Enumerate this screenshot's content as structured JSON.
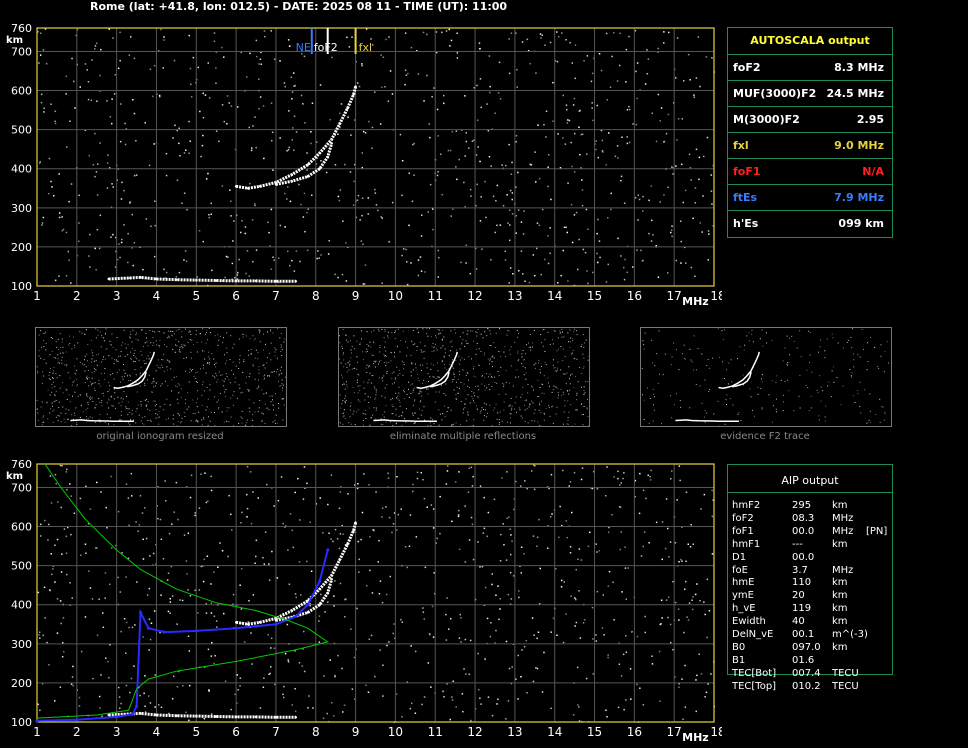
{
  "header": {
    "title": "Rome (lat: +41.8, lon: 012.5) - DATE: 2025 08 11 - TIME (UT): 11:00"
  },
  "axes": {
    "x_ticks": [
      "1",
      "2",
      "3",
      "4",
      "5",
      "6",
      "7",
      "8",
      "9",
      "10",
      "11",
      "12",
      "13",
      "14",
      "15",
      "16",
      "17",
      "18"
    ],
    "y_ticks": [
      "100",
      "200",
      "300",
      "400",
      "500",
      "600",
      "700",
      "760"
    ],
    "x_unit": "MHz",
    "y_unit": "km"
  },
  "markers": {
    "ne": "NE",
    "fof2": "foF2",
    "fxl": "fxl"
  },
  "autoscala": {
    "title": "AUTOSCALA output",
    "rows": [
      {
        "key": "foF2",
        "value": "8.3 MHz",
        "color": "#ffffff"
      },
      {
        "key": "MUF(3000)F2",
        "value": "24.5 MHz",
        "color": "#ffffff"
      },
      {
        "key": "M(3000)F2",
        "value": "2.95",
        "color": "#ffffff"
      },
      {
        "key": "fxl",
        "value": "9.0 MHz",
        "color": "#e6d23c"
      },
      {
        "key": "foF1",
        "value": "N/A",
        "color": "#ff2020"
      },
      {
        "key": "ftEs",
        "value": "7.9 MHz",
        "color": "#3a7bff"
      },
      {
        "key": "h'Es",
        "value": "099     km",
        "color": "#ffffff"
      }
    ]
  },
  "thumbnails": [
    {
      "caption": "original ionogram resized"
    },
    {
      "caption": "eliminate multiple reflections"
    },
    {
      "caption": "evidence F2 trace"
    }
  ],
  "aip": {
    "title": "AIP output",
    "rows": [
      {
        "k": "hmF2",
        "v": "295",
        "u": "km",
        "x": ""
      },
      {
        "k": "foF2",
        "v": "08.3",
        "u": "MHz",
        "x": ""
      },
      {
        "k": "foF1",
        "v": "00.0",
        "u": "MHz",
        "x": "[PN]"
      },
      {
        "k": "hmF1",
        "v": "---",
        "u": "km",
        "x": ""
      },
      {
        "k": "D1",
        "v": "00.0",
        "u": "",
        "x": ""
      },
      {
        "k": "foE",
        "v": "3.7",
        "u": "MHz",
        "x": ""
      },
      {
        "k": "hmE",
        "v": "110",
        "u": "km",
        "x": ""
      },
      {
        "k": "ymE",
        "v": "20",
        "u": "km",
        "x": ""
      },
      {
        "k": "h_vE",
        "v": "119",
        "u": "km",
        "x": ""
      },
      {
        "k": "Ewidth",
        "v": "40",
        "u": "km",
        "x": ""
      },
      {
        "k": "DelN_vE",
        "v": "00.1",
        "u": "m^(-3)",
        "x": ""
      },
      {
        "k": "B0",
        "v": "097.0",
        "u": "km",
        "x": ""
      },
      {
        "k": "B1",
        "v": "01.6",
        "u": "",
        "x": ""
      },
      {
        "k": "TEC[Bot]",
        "v": "007.4",
        "u": "TECU",
        "x": ""
      },
      {
        "k": "TEC[Top]",
        "v": "010.2",
        "u": "TECU",
        "x": ""
      }
    ]
  },
  "chart_data": [
    {
      "type": "scatter",
      "xlim": [
        1,
        18
      ],
      "ylim": [
        100,
        760
      ],
      "grid": true,
      "series": [
        {
          "color": "#ffffff",
          "x": [
            6.0,
            6.3,
            6.6,
            7.0,
            7.4,
            7.8,
            8.1,
            8.4,
            8.6,
            8.8,
            8.95,
            9.0
          ],
          "y": [
            355,
            350,
            355,
            365,
            385,
            410,
            440,
            475,
            515,
            555,
            590,
            610
          ]
        },
        {
          "color": "#ffffff",
          "x": [
            7.0,
            7.4,
            7.8,
            8.1,
            8.3,
            8.4
          ],
          "y": [
            360,
            368,
            380,
            400,
            430,
            465
          ]
        },
        {
          "color": "#ffffff",
          "x": [
            2.8,
            3.2,
            3.6,
            4.0,
            4.5,
            5.0,
            5.5,
            6.0,
            6.5,
            7.0,
            7.5
          ],
          "y": [
            118,
            120,
            122,
            118,
            116,
            115,
            114,
            113,
            113,
            112,
            112
          ]
        }
      ],
      "markers": [
        {
          "label": "NE",
          "x": 7.9,
          "color": "#3a7bff"
        },
        {
          "label": "foF2",
          "x": 8.3,
          "color": "#ffffff"
        },
        {
          "label": "fxl",
          "x": 9.0,
          "color": "#e6d23c"
        }
      ]
    },
    {
      "type": "line",
      "xlim": [
        1,
        18
      ],
      "ylim": [
        100,
        760
      ],
      "grid": true,
      "series": [
        {
          "color": "#ffffff",
          "x": [
            6.0,
            6.3,
            6.6,
            7.0,
            7.4,
            7.8,
            8.1,
            8.4,
            8.6,
            8.8,
            8.95,
            9.0
          ],
          "y": [
            355,
            350,
            355,
            365,
            385,
            410,
            440,
            475,
            515,
            555,
            590,
            610
          ]
        },
        {
          "color": "#ffffff",
          "x": [
            7.0,
            7.4,
            7.8,
            8.1,
            8.3,
            8.4
          ],
          "y": [
            360,
            368,
            380,
            400,
            430,
            465
          ]
        },
        {
          "color": "#ffffff",
          "x": [
            2.8,
            3.2,
            3.6,
            4.0,
            4.5,
            5.0,
            5.5,
            6.0,
            6.5,
            7.0,
            7.5
          ],
          "y": [
            118,
            120,
            122,
            118,
            116,
            115,
            114,
            113,
            113,
            112,
            112
          ]
        },
        {
          "color": "#2a2aff",
          "x": [
            1.0,
            2.0,
            3.0,
            3.4,
            3.5,
            3.6,
            3.8,
            4.2,
            5.0,
            6.0,
            6.5,
            7.0,
            7.5,
            7.8,
            8.1,
            8.3
          ],
          "y": [
            103,
            106,
            113,
            120,
            140,
            380,
            340,
            330,
            333,
            340,
            345,
            350,
            370,
            400,
            460,
            540
          ]
        },
        {
          "color": "#00cc00",
          "x": [
            1.2,
            1.6,
            2.2,
            3.0,
            3.6,
            4.5,
            5.5,
            6.5,
            7.3,
            7.8,
            8.3,
            7.5,
            6.0,
            4.5,
            3.8,
            3.5,
            3.3,
            2.5,
            1.0
          ],
          "y": [
            760,
            700,
            620,
            540,
            490,
            440,
            405,
            385,
            360,
            340,
            305,
            285,
            255,
            230,
            210,
            185,
            130,
            118,
            110
          ]
        }
      ]
    }
  ]
}
